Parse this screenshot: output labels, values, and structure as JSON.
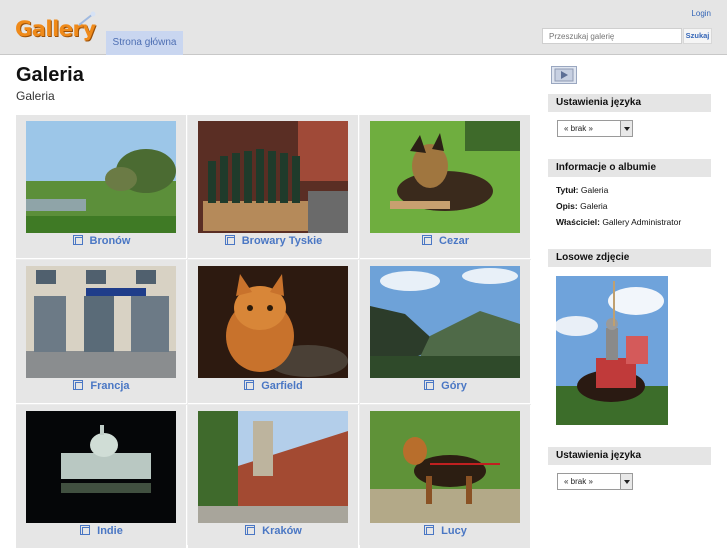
{
  "header": {
    "logo_text": "Gallery",
    "home_tab": "Strona główna",
    "login": "Login",
    "search_placeholder": "Przeszukaj galerię",
    "search_button": "Szukaj"
  },
  "page": {
    "title": "Galeria",
    "subtitle": "Galeria"
  },
  "albums": [
    {
      "label": "Bronów"
    },
    {
      "label": "Browary Tyskie"
    },
    {
      "label": "Cezar"
    },
    {
      "label": "Francja"
    },
    {
      "label": "Garfield"
    },
    {
      "label": "Góry"
    },
    {
      "label": "Indie"
    },
    {
      "label": "Kraków"
    },
    {
      "label": "Lucy"
    }
  ],
  "sidebar": {
    "lang_title_1": "Ustawienia języka",
    "lang_value": "« brak »",
    "album_info_title": "Informacje o albumie",
    "title_label": "Tytuł:",
    "title_value": "Galeria",
    "desc_label": "Opis:",
    "desc_value": "Galeria",
    "owner_label": "Właściciel:",
    "owner_value": "Gallery Administrator",
    "random_title": "Losowe zdjęcie",
    "lang_title_2": "Ustawienia języka"
  },
  "colors": {
    "link_blue": "#4a77c4",
    "tab_bg": "#c9d6f0",
    "logo_orange": "#ef8a1a"
  },
  "icons": [
    "slideshow-icon",
    "album-icon",
    "select-arrow-icon"
  ]
}
